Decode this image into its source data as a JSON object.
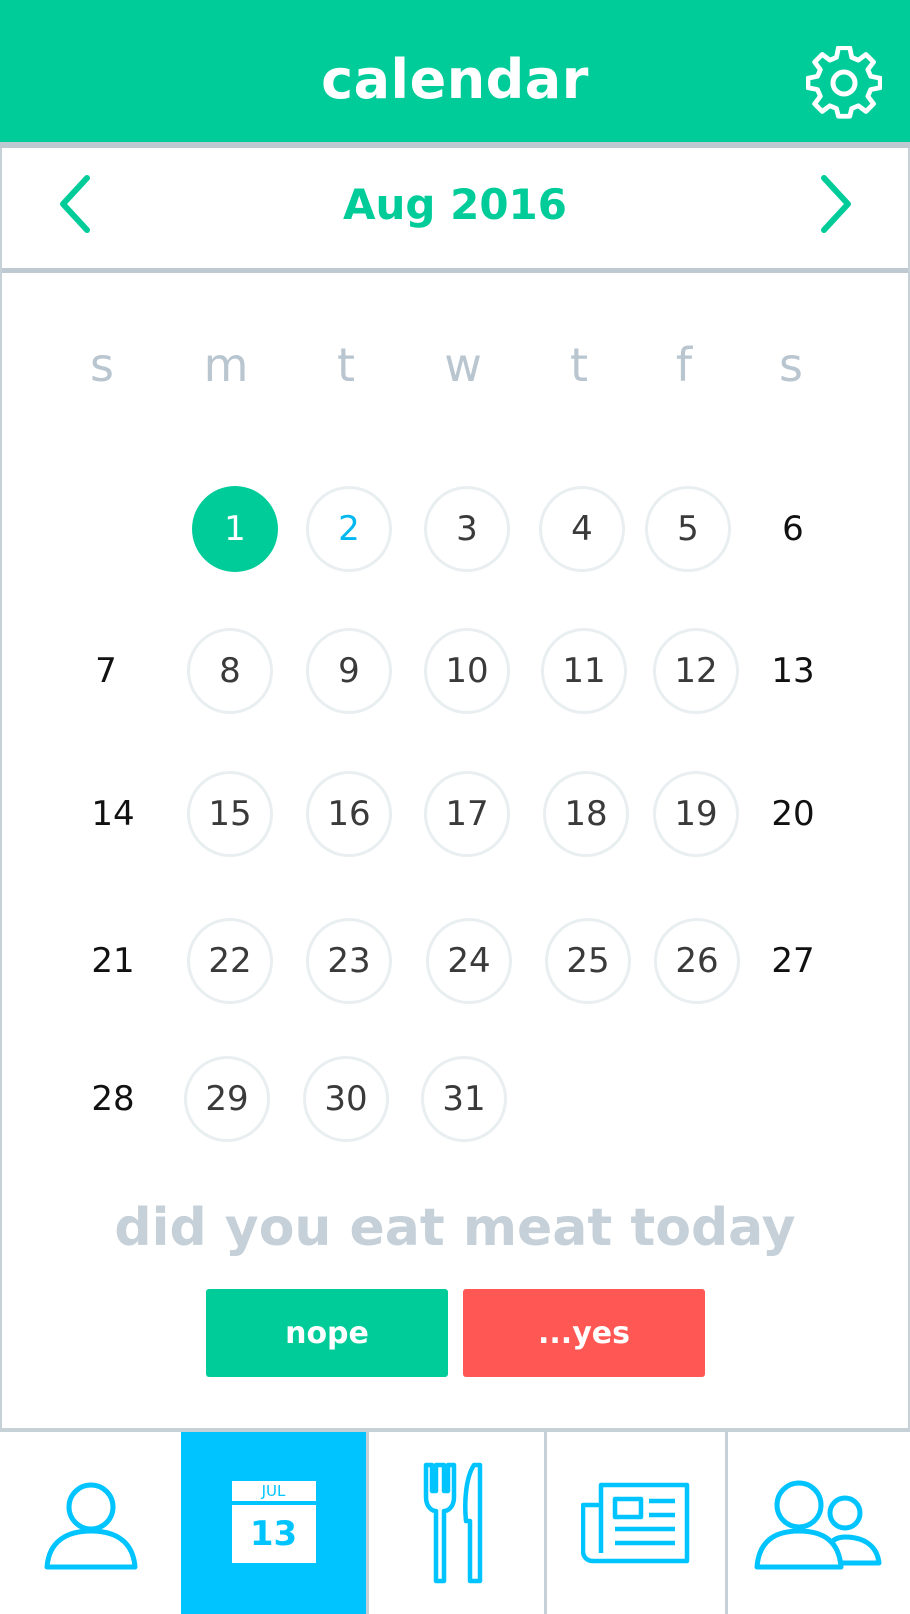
{
  "header": {
    "title": "calendar"
  },
  "nav": {
    "month_label": "Aug 2016"
  },
  "weekdays": [
    "s",
    "m",
    "t",
    "w",
    "t",
    "f",
    "s"
  ],
  "days": {
    "d1": "1",
    "d2": "2",
    "d3": "3",
    "d4": "4",
    "d5": "5",
    "d6": "6",
    "d7": "7",
    "d8": "8",
    "d9": "9",
    "d10": "10",
    "d11": "11",
    "d12": "12",
    "d13": "13",
    "d14": "14",
    "d15": "15",
    "d16": "16",
    "d17": "17",
    "d18": "18",
    "d19": "19",
    "d20": "20",
    "d21": "21",
    "d22": "22",
    "d23": "23",
    "d24": "24",
    "d25": "25",
    "d26": "26",
    "d27": "27",
    "d28": "28",
    "d29": "29",
    "d30": "30",
    "d31": "31"
  },
  "selected_day": "1",
  "question": "did you eat meat today",
  "buttons": {
    "no": "nope",
    "yes": "...yes"
  },
  "tabbar": {
    "calendar_icon_month": "JUL",
    "calendar_icon_day": "13",
    "tabs": [
      "profile-icon",
      "calendar-icon",
      "fork-knife-icon",
      "newspaper-icon",
      "group-icon"
    ]
  },
  "colors": {
    "accent": "#00cc99",
    "active_tab": "#00c4ff",
    "danger": "#ff5754",
    "muted": "#c5d0d8"
  }
}
